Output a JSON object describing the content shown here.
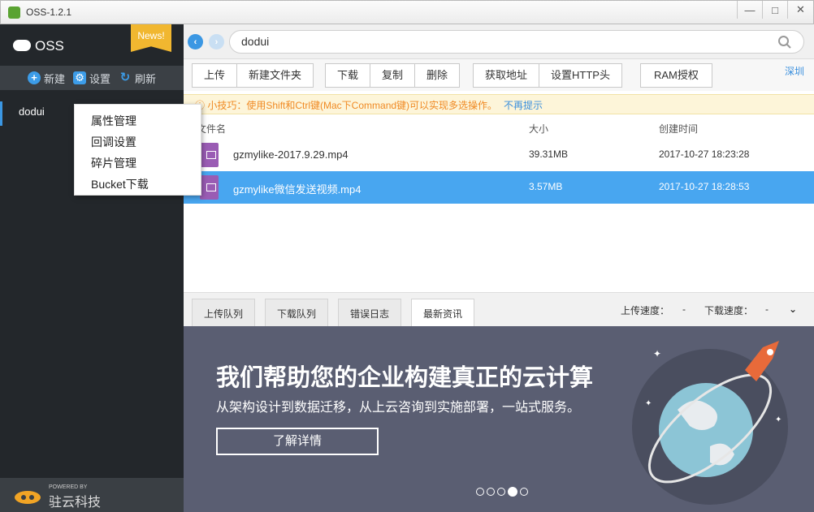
{
  "window": {
    "title": "OSS-1.2.1"
  },
  "sidebar": {
    "logo": "OSS",
    "badge": "News!",
    "actions": [
      {
        "label": "新建",
        "icon": "plus-circle-icon"
      },
      {
        "label": "设置",
        "icon": "gear-icon"
      },
      {
        "label": "刷新",
        "icon": "refresh-icon"
      }
    ],
    "bucket": "dodui",
    "footer_powered": "POWERED BY",
    "footer_name": "驻云科技"
  },
  "context_menu": {
    "items": [
      "属性管理",
      "回调设置",
      "碎片管理",
      "Bucket下载"
    ]
  },
  "address": {
    "path": "dodui"
  },
  "toolbar": {
    "group1": [
      "上传",
      "新建文件夹"
    ],
    "group2": [
      "下载",
      "复制",
      "删除"
    ],
    "group3": [
      "获取地址",
      "设置HTTP头"
    ],
    "group4": [
      "RAM授权"
    ],
    "region": "深圳"
  },
  "tip": {
    "text": "小技巧：使用Shift和Ctrl键(Mac下Command键)可以实现多选操作。",
    "link": "不再提示"
  },
  "table": {
    "headers": [
      "文件名",
      "大小",
      "创建时间"
    ],
    "rows": [
      {
        "name": "gzmylike-2017.9.29.mp4",
        "size": "39.31MB",
        "created": "2017-10-27 18:23:28",
        "selected": false
      },
      {
        "name": "gzmylike微信发送视频.mp4",
        "size": "3.57MB",
        "created": "2017-10-27 18:28:53",
        "selected": true
      }
    ]
  },
  "tabs": {
    "items": [
      "上传队列",
      "下载队列",
      "错误日志",
      "最新资讯"
    ],
    "active": "最新资讯"
  },
  "speed": {
    "upload_label": "上传速度：",
    "upload_value": "-",
    "download_label": "下载速度：",
    "download_value": "-"
  },
  "banner": {
    "headline": "我们帮助您的企业构建真正的云计算",
    "subline": "从架构设计到数据迁移，从上云咨询到实施部署，一站式服务。",
    "button": "了解详情",
    "slides": 5,
    "active_slide": 4
  },
  "colors": {
    "accent": "#3b97e3",
    "selected_row": "#48a6f0",
    "tip_text": "#f08a24",
    "badge": "#f1b730"
  }
}
